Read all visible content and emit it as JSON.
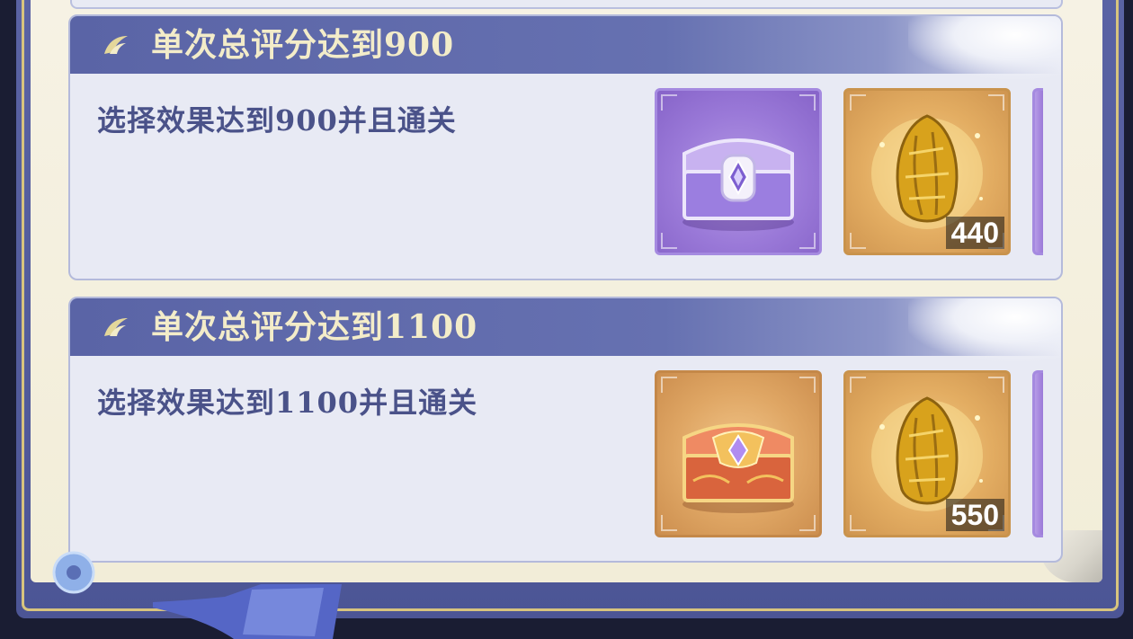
{
  "theme": {
    "header_color": "#5a64a6",
    "title_color": "#f3ecc9",
    "desc_color": "#4a5289",
    "card_bg": "#e8eaf4"
  },
  "tasks": [
    {
      "title": "单次总评分达到900",
      "description": "选择效果达到900并且通关",
      "rewards": [
        {
          "icon": "purple-chest-icon",
          "rarity": "purple"
        },
        {
          "icon": "golden-seed-icon",
          "rarity": "gold",
          "count": "440"
        }
      ]
    },
    {
      "title": "单次总评分达到1100",
      "description": "选择效果达到1100并且通关",
      "rewards": [
        {
          "icon": "orange-chest-icon",
          "rarity": "orange"
        },
        {
          "icon": "golden-seed-icon",
          "rarity": "gold",
          "count": "550"
        }
      ]
    }
  ]
}
